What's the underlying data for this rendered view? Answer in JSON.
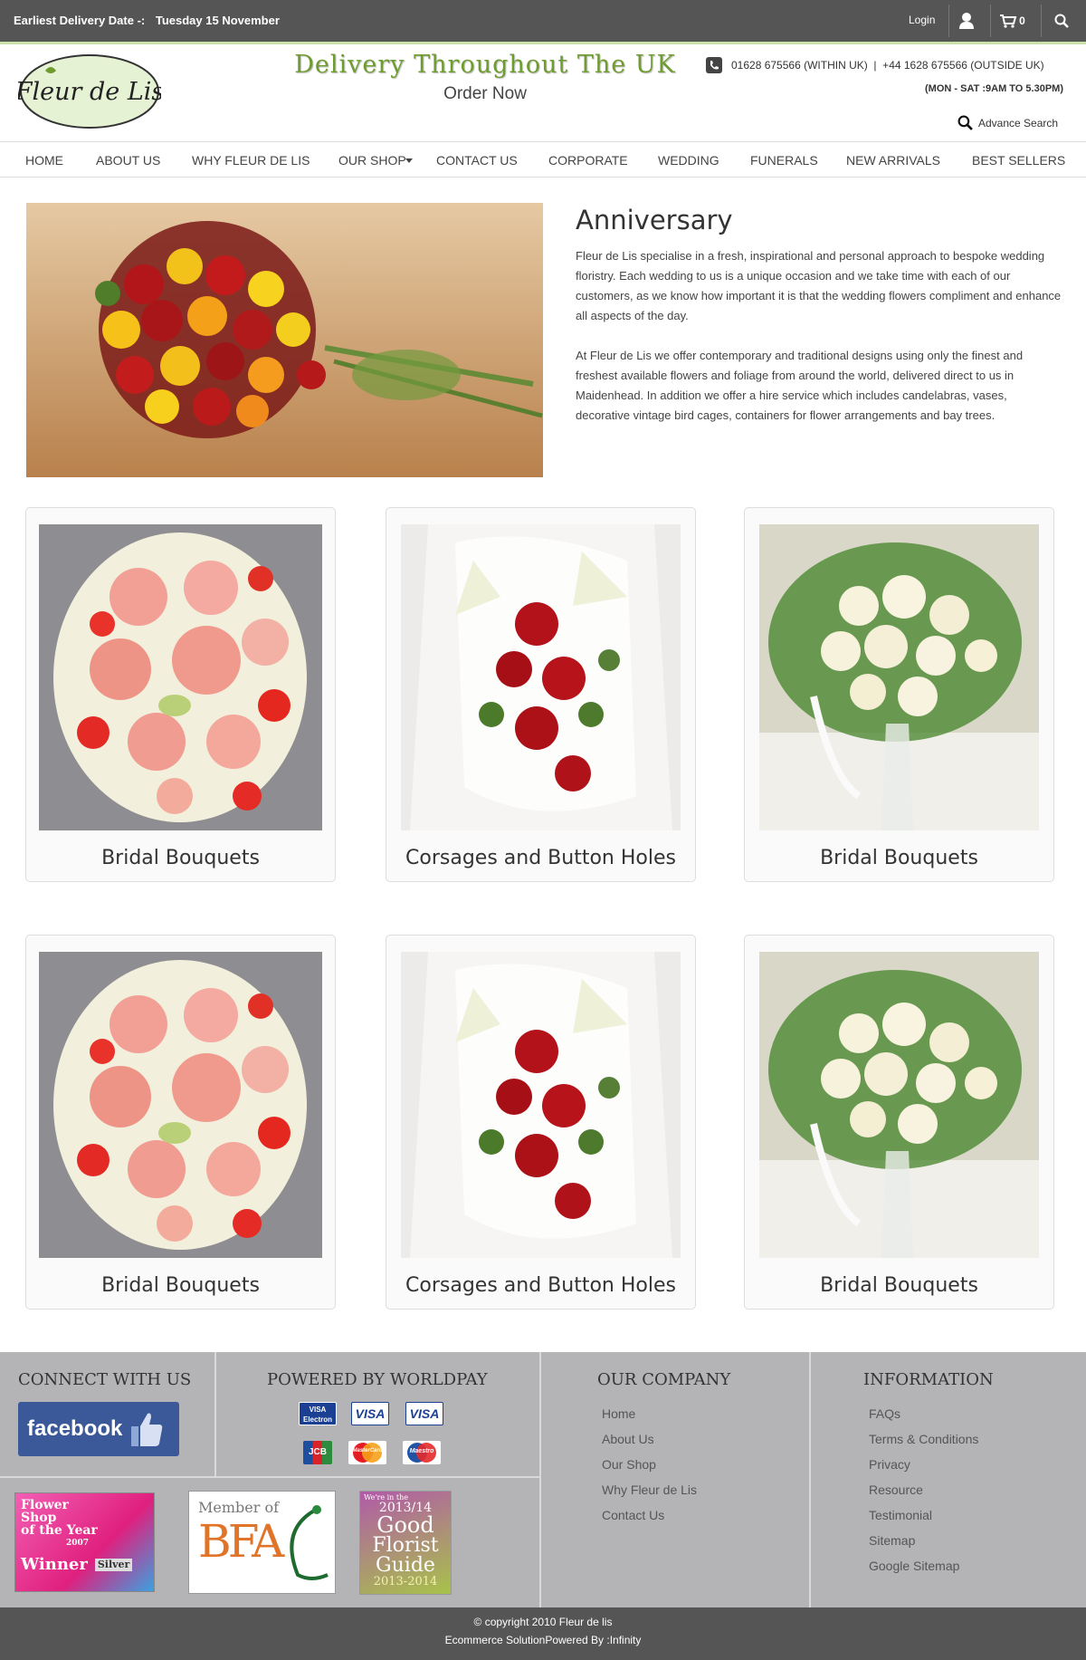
{
  "topbar": {
    "delivery_label": "Earliest Delivery Date -:",
    "delivery_date": "Tuesday 15 November",
    "login": "Login",
    "cart_count": "0"
  },
  "header": {
    "logo_text": "Fleur de Lis",
    "tagline": "Delivery Throughout The UK",
    "order_now": "Order Now",
    "phone": "01628 675566 (WITHIN UK)  |  +44 1628 675566 (OUTSIDE UK)",
    "hours": "(MON - SAT :9AM TO 5.30PM)",
    "advance_search": "Advance Search"
  },
  "nav": [
    "HOME",
    "ABOUT US",
    "WHY FLEUR DE LIS",
    "OUR SHOP",
    "CONTACT US",
    "CORPORATE",
    "WEDDING",
    "FUNERALS",
    "NEW ARRIVALS",
    "BEST SELLERS"
  ],
  "intro": {
    "title": "Anniversary",
    "p1": "Fleur de Lis specialise in a fresh, inspirational and personal approach to bespoke wedding floristry. Each wedding to us is a unique occasion and we take time with each of our customers, as we know how important it is that the wedding flowers compliment and enhance all aspects of the day.",
    "p2": "At Fleur de Lis we offer contemporary and traditional designs using only the finest and freshest available flowers and foliage from around the world, delivered direct to us in Maidenhead. In addition we offer a hire service which includes candelabras, vases, decorative vintage bird cages, containers for flower arrangements and bay trees."
  },
  "products": [
    {
      "title": "Bridal Bouquets"
    },
    {
      "title": "Corsages and Button Holes"
    },
    {
      "title": "Bridal Bouquets"
    },
    {
      "title": "Bridal Bouquets"
    },
    {
      "title": "Corsages and Button Holes"
    },
    {
      "title": "Bridal Bouquets"
    }
  ],
  "footer": {
    "connect": "CONNECT WITH US",
    "facebook": "facebook",
    "powered": "POWERED BY WORLDPAY",
    "payments": [
      "VISA Electron",
      "VISA",
      "VISA",
      "JCB",
      "MasterCard",
      "Maestro"
    ],
    "company_title": "OUR COMPANY",
    "company_links": [
      "Home",
      "About Us",
      "Our Shop",
      "Why Fleur de Lis",
      "Contact Us"
    ],
    "info_title": "INFORMATION",
    "info_links": [
      "FAQs",
      "Terms & Conditions",
      "Privacy",
      "Resource",
      "Testimonial",
      "Sitemap",
      "Google Sitemap"
    ],
    "badge1": [
      "Flower",
      "Shop",
      "of the Year",
      "2007",
      "Winner",
      "Silver"
    ],
    "badge2": [
      "Member of",
      "BFA"
    ],
    "badge3": [
      "We're in the",
      "2013/14",
      "Good",
      "Florist",
      "Guide",
      "2013-2014"
    ]
  },
  "copyright": {
    "line1": "© copyright 2010 Fleur de lis",
    "line2": "Ecommerce SolutionPowered By :Infinity"
  },
  "colors": {
    "topbar": "#555555",
    "accent_green": "#6e9c2f",
    "footer": "#b4b4b6",
    "facebook": "#3b5998"
  }
}
